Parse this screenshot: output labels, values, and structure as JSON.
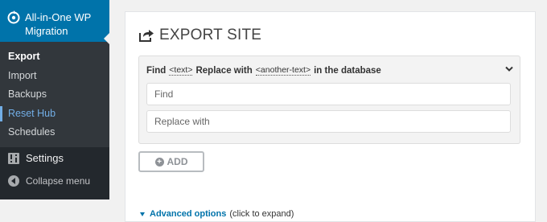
{
  "sidebar": {
    "plugin_title": "All-in-One WP Migration",
    "icons": {
      "plugin": "plugin-logo-icon",
      "settings": "settings-icon",
      "collapse": "collapse-icon"
    },
    "items": [
      {
        "label": "Export"
      },
      {
        "label": "Import"
      },
      {
        "label": "Backups"
      },
      {
        "label": "Reset Hub"
      },
      {
        "label": "Schedules"
      }
    ],
    "settings_label": "Settings",
    "collapse_label": "Collapse menu"
  },
  "main": {
    "title": "EXPORT SITE",
    "title_icon": "export-icon",
    "find_replace": {
      "find_word": "Find",
      "text_token": "<text>",
      "replace_word": "Replace with",
      "another_token": "<another-text>",
      "suffix": "in the database",
      "find_placeholder": "Find",
      "replace_placeholder": "Replace with"
    },
    "add_button": "ADD",
    "advanced_label": "Advanced options",
    "advanced_hint": "(click to expand)"
  },
  "colors": {
    "sidebar_bg": "#23282d",
    "sidebar_accent": "#0073aa",
    "link": "#0073aa",
    "highlight": "#72aee6"
  }
}
